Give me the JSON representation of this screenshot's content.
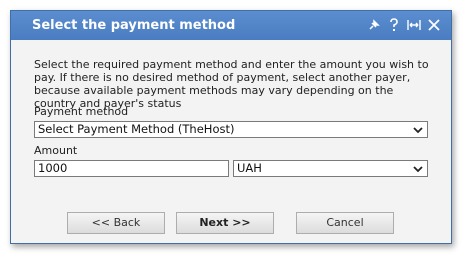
{
  "dialog": {
    "title": "Select the payment method",
    "icons": [
      "pin-icon",
      "help-icon",
      "resize-icon",
      "close-icon"
    ]
  },
  "description": "Select the required payment method and enter the amount you wish to pay. If there is no desired method of payment, select another payer, because available payment methods may vary depending on the country and payer's status",
  "payment_method": {
    "label": "Payment method",
    "selected": "Select Payment Method (TheHost)"
  },
  "amount": {
    "label": "Amount",
    "value": "1000",
    "currency": "UAH"
  },
  "buttons": {
    "back": "<< Back",
    "next": "Next >>",
    "cancel": "Cancel"
  },
  "colors": {
    "titlebar": "#4a7cc1",
    "dialog_bg": "#f3f3f3"
  }
}
